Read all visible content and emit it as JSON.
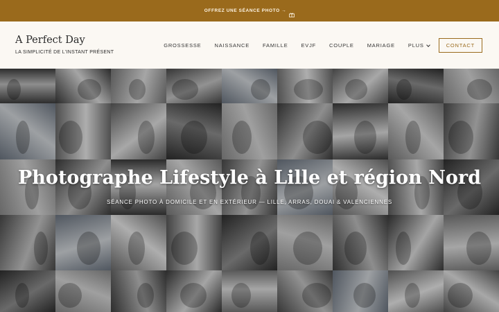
{
  "promo": {
    "text": "OFFREZ UNE SÉANCE PHOTO →",
    "icon": "gift-icon"
  },
  "brand": {
    "title": "A Perfect Day",
    "tagline": "LA SIMPLICITÉ DE L'INSTANT PRÉSENT"
  },
  "nav": {
    "items": [
      "GROSSESSE",
      "NAISSANCE",
      "FAMILLE",
      "EVJF",
      "COUPLE",
      "MARIAGE"
    ],
    "more_label": "PLUS",
    "contact_label": "CONTACT"
  },
  "hero": {
    "title": "Photographe Lifestyle à Lille et région Nord",
    "subtitle": "SÉANCE PHOTO À DOMICILE ET EN EXTÉRIEUR — LILLE, ARRAS, DOUAI & VALENCIENNES"
  },
  "colors": {
    "accent": "#9a6a1c",
    "background": "#fbf8f3",
    "text": "#2a2a2a"
  }
}
